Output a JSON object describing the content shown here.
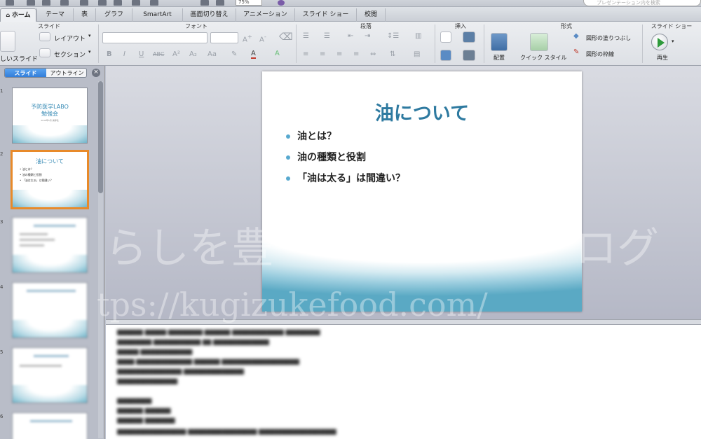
{
  "toolbar": {
    "zoom": "75%",
    "search_placeholder": "プレゼンテーション内を検索"
  },
  "tabs": [
    {
      "label": "ホーム",
      "active": true
    },
    {
      "label": "テーマ"
    },
    {
      "label": "表"
    },
    {
      "label": "グラフ"
    },
    {
      "label": "SmartArt"
    },
    {
      "label": "画面切り替え"
    },
    {
      "label": "アニメーション"
    },
    {
      "label": "スライド ショー"
    },
    {
      "label": "校閲"
    }
  ],
  "ribbon": {
    "groups": {
      "slide": "スライド",
      "font": "フォント",
      "paragraph": "段落",
      "insert": "挿入",
      "format": "形式",
      "slideshow": "スライド ショー"
    },
    "new_slide_label": "しいスライド",
    "layout_label": "レイアウト",
    "section_label": "セクション",
    "arrange_label": "配置",
    "quick_style_label": "クイック スタイル",
    "shape_fill_label": "図形の塗りつぶし",
    "shape_outline_label": "図形の枠線",
    "play_label": "再生"
  },
  "panel": {
    "tab_slides": "スライド",
    "tab_outline": "アウトライン"
  },
  "thumbnails": [
    {
      "num": "1",
      "title_line1": "予防医学LABO",
      "title_line2": "勉強会",
      "subtitle": "2016年5月 講師名"
    },
    {
      "num": "2",
      "title": "油について",
      "lines": [
        "• 油とは？",
        "• 油の種類と役割",
        "• 「油は太る」は間違い？"
      ]
    },
    {
      "num": "3"
    },
    {
      "num": "4"
    },
    {
      "num": "5"
    },
    {
      "num": "6"
    }
  ],
  "slide": {
    "title": "油について",
    "bullets": [
      "油とは？",
      "油の種類と役割",
      "「油は太る」は間違い？"
    ]
  },
  "watermark": {
    "line1": "らしを豊",
    "line1b": "ログ",
    "line2": "tps://kugizukefood.com/"
  },
  "colors": {
    "accent": "#2e7aa0",
    "bullet": "#58a9cf",
    "selection": "#e88a2a",
    "panel_tab": "#2f7ad8"
  }
}
